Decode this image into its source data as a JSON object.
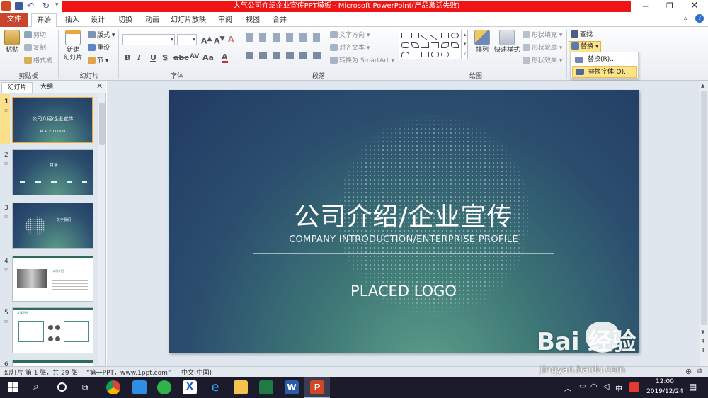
{
  "window": {
    "title": "大气公司介绍企业宣传PPT模板 - Microsoft PowerPoint(产品激活失败)"
  },
  "tabs": [
    {
      "label": "文件"
    },
    {
      "label": "开始"
    },
    {
      "label": "插入"
    },
    {
      "label": "设计"
    },
    {
      "label": "切换"
    },
    {
      "label": "动画"
    },
    {
      "label": "幻灯片放映"
    },
    {
      "label": "审阅"
    },
    {
      "label": "视图"
    },
    {
      "label": "合并"
    }
  ],
  "ribbon": {
    "clipboard": {
      "paste": "粘贴",
      "cut": "剪切",
      "copy": "复制",
      "format_painter": "格式刷",
      "group": "剪贴板"
    },
    "slides": {
      "new_slide_line1": "新建",
      "new_slide_line2": "幻灯片",
      "layout": "版式",
      "reset": "重设",
      "section": "节",
      "group": "幻灯片"
    },
    "font": {
      "group": "字体"
    },
    "paragraph": {
      "text_direction": "文字方向",
      "align_text": "对齐文本",
      "convert_smartart": "转换为 SmartArt",
      "group": "段落"
    },
    "drawing": {
      "arrange": "排列",
      "quick_styles": "快速样式",
      "shape_fill": "形状填充",
      "shape_outline": "形状轮廓",
      "shape_effects": "形状效果",
      "group": "绘图"
    },
    "editing": {
      "find": "查找",
      "replace": "替换"
    }
  },
  "replace_menu": {
    "items": [
      {
        "label": "替换(R)..."
      },
      {
        "label": "替换字体(O)..."
      }
    ]
  },
  "left_panel": {
    "tabs": [
      {
        "label": "幻灯片"
      },
      {
        "label": "大纲"
      }
    ],
    "slides": [
      {
        "num": "1",
        "title": "公司介绍/企业宣传",
        "sub": "PLACED LOGO"
      },
      {
        "num": "2",
        "title": "目录"
      },
      {
        "num": "3",
        "title": "关于我们"
      },
      {
        "num": "4",
        "title": "公司介绍"
      },
      {
        "num": "5",
        "title": "发展历程"
      },
      {
        "num": "6",
        "title": ""
      }
    ]
  },
  "slide": {
    "title": "公司介绍/企业宣传",
    "subtitle": "COMPANY INTRODUCTION/ENTERPRISE PROFILE",
    "logo": "PLACED LOGO"
  },
  "status": {
    "slide_info": "幻灯片 第 1 张，共 29 张",
    "theme": "“第一PPT，www.1ppt.com”",
    "language": "中文(中国)"
  },
  "taskbar": {
    "time": "12:00",
    "date": "2019/12/24",
    "ime": "中"
  },
  "watermark": {
    "text": "Bai  经验",
    "url": "jingyan.baidu.com"
  }
}
